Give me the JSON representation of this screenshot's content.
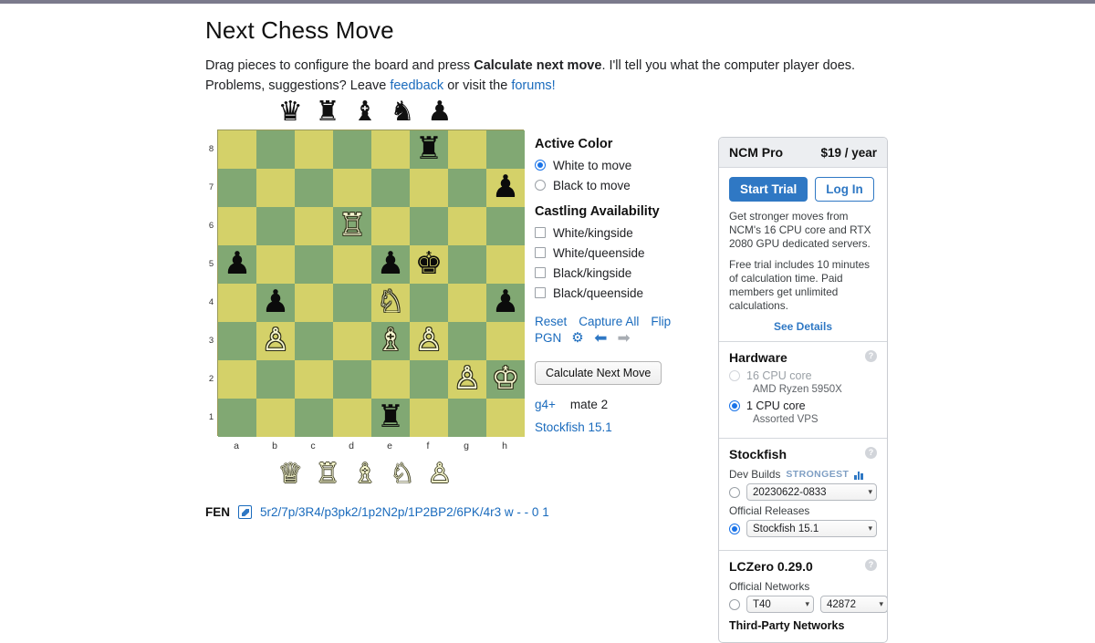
{
  "header": {
    "title": "Next Chess Move",
    "intro_1a": "Drag pieces to configure the board and press ",
    "intro_1b": "Calculate next move",
    "intro_1c": ". I'll tell you what the computer player does.",
    "intro_2a": "Problems, suggestions? Leave ",
    "intro_2b": "feedback",
    "intro_2c": " or visit the ",
    "intro_2d": "forums!"
  },
  "board": {
    "fen": "5r2/7p/3R4/p3pk2/1p2N2p/1P2BP2/6PK/4r3 w - - 0 1",
    "fen_label": "FEN",
    "files": [
      "a",
      "b",
      "c",
      "d",
      "e",
      "f",
      "g",
      "h"
    ],
    "ranks": [
      "8",
      "7",
      "6",
      "5",
      "4",
      "3",
      "2",
      "1"
    ],
    "light_color": "#d4d169",
    "dark_color": "#81a873",
    "captured_black": [
      "queen",
      "rook",
      "bishop",
      "knight",
      "pawn"
    ],
    "captured_white": [
      "queen",
      "rook",
      "bishop",
      "knight",
      "pawn"
    ],
    "rows": [
      [
        "",
        "",
        "",
        "",
        "",
        "black-rook",
        "",
        ""
      ],
      [
        "",
        "",
        "",
        "",
        "",
        "",
        "",
        "black-pawn"
      ],
      [
        "",
        "",
        "",
        "white-rook",
        "",
        "",
        "",
        ""
      ],
      [
        "black-pawn",
        "",
        "",
        "",
        "black-pawn",
        "black-king",
        "",
        ""
      ],
      [
        "",
        "black-pawn",
        "",
        "",
        "white-knight",
        "",
        "",
        "black-pawn"
      ],
      [
        "",
        "white-pawn",
        "",
        "",
        "white-bishop",
        "white-pawn",
        "",
        ""
      ],
      [
        "",
        "",
        "",
        "",
        "",
        "",
        "white-pawn",
        "white-king"
      ],
      [
        "",
        "",
        "",
        "",
        "black-rook",
        "",
        "",
        ""
      ]
    ]
  },
  "controls": {
    "active_color_title": "Active Color",
    "white_to_move": "White to move",
    "black_to_move": "Black to move",
    "active_selected": "white",
    "castling_title": "Castling Availability",
    "castling": [
      {
        "label": "White/kingside",
        "checked": false
      },
      {
        "label": "White/queenside",
        "checked": false
      },
      {
        "label": "Black/kingside",
        "checked": false
      },
      {
        "label": "Black/queenside",
        "checked": false
      }
    ],
    "reset": "Reset",
    "capture_all": "Capture All",
    "flip": "Flip",
    "pgn": "PGN",
    "gear_icon": "gear-icon",
    "back_icon": "arrow-left-icon",
    "forward_icon": "arrow-right-icon",
    "calculate_button": "Calculate Next Move",
    "best_move": "g4+",
    "evaluation": "mate 2",
    "engine_used": "Stockfish 15.1"
  },
  "sidebar": {
    "pro": {
      "title": "NCM Pro",
      "price": "$19 / year",
      "start_trial": "Start Trial",
      "log_in": "Log In",
      "desc1": "Get stronger moves from NCM's 16 CPU core and RTX 2080 GPU dedicated servers.",
      "desc2": "Free trial includes 10 minutes of calculation time. Paid members get unlimited calculations.",
      "see_details": "See Details"
    },
    "hardware": {
      "title": "Hardware",
      "options": [
        {
          "label": "16 CPU core",
          "sub": "AMD Ryzen 5950X",
          "selected": false,
          "disabled": true
        },
        {
          "label": "1 CPU core",
          "sub": "Assorted VPS",
          "selected": true,
          "disabled": false
        }
      ]
    },
    "stockfish": {
      "title": "Stockfish",
      "dev_builds_label": "Dev Builds",
      "strongest_badge": "STRONGEST",
      "dev_build_value": "20230622-0833",
      "dev_selected": false,
      "official_label": "Official Releases",
      "official_value": "Stockfish 15.1",
      "official_selected": true
    },
    "lczero": {
      "title": "LCZero 0.29.0",
      "official_networks_label": "Official Networks",
      "network_value": "T40",
      "network_id": "42872",
      "selected": false,
      "third_party_label": "Third-Party Networks"
    }
  }
}
